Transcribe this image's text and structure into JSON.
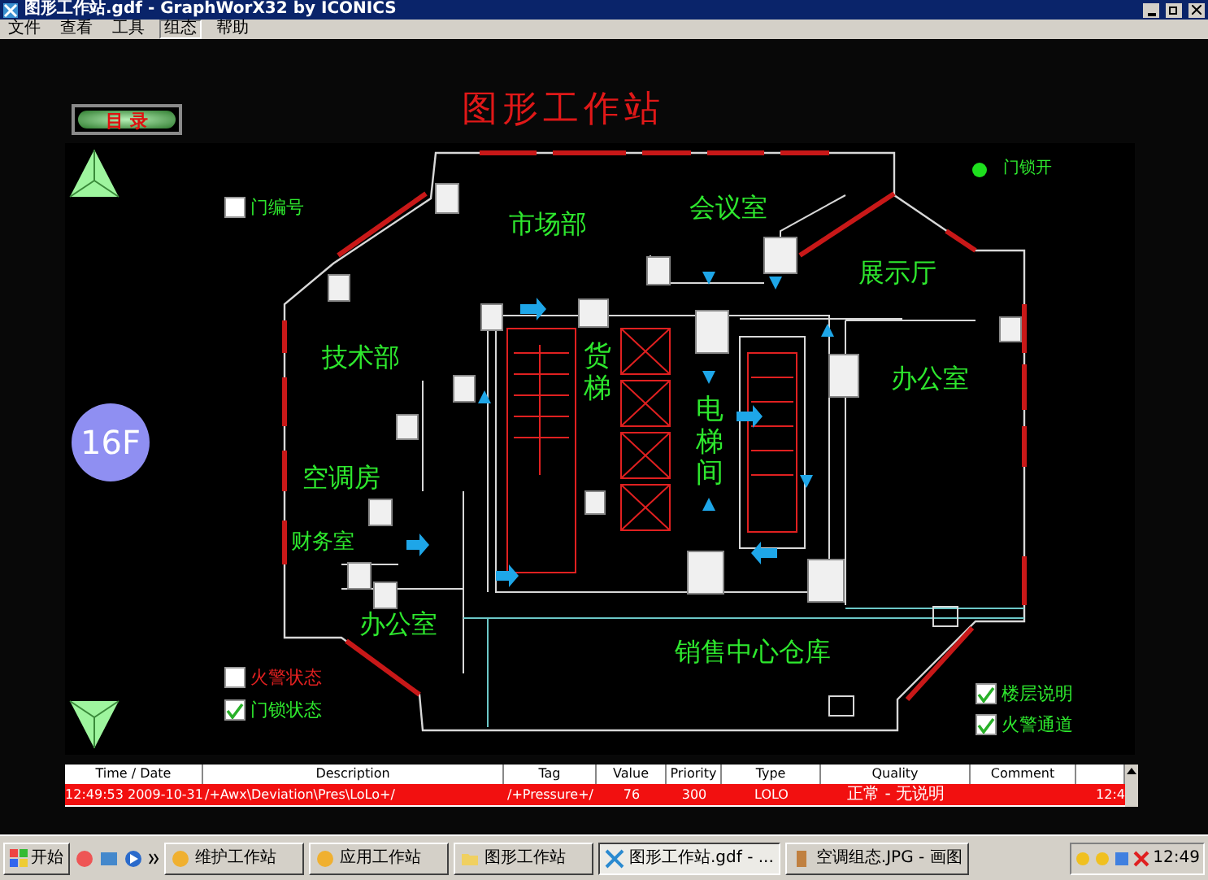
{
  "window": {
    "title": "图形工作站.gdf - GraphWorX32 by ICONICS"
  },
  "menu": [
    {
      "label": "文件",
      "selected": false
    },
    {
      "label": "查看",
      "selected": false
    },
    {
      "label": "工具",
      "selected": false
    },
    {
      "label": "组态",
      "selected": true
    },
    {
      "label": "帮助",
      "selected": false
    }
  ],
  "header": {
    "menu_button": "目 录",
    "title": "图形工作站"
  },
  "floor": {
    "label": "16F"
  },
  "rooms": [
    {
      "name": "市场部"
    },
    {
      "name": "会议室"
    },
    {
      "name": "展示厅"
    },
    {
      "name": "技术部"
    },
    {
      "name": "办公室"
    },
    {
      "name": "货梯"
    },
    {
      "name": "电梯间"
    },
    {
      "name": "空调房"
    },
    {
      "name": "财务室"
    },
    {
      "name": "办公室"
    },
    {
      "name": "销售中心仓库"
    }
  ],
  "legend": [
    {
      "label": "门编号",
      "checked": false,
      "kind": "normal"
    },
    {
      "label": "火警状态",
      "checked": false,
      "kind": "fire"
    },
    {
      "label": "门锁状态",
      "checked": true,
      "kind": "normal"
    },
    {
      "label": "楼层说明",
      "checked": true,
      "kind": "normal"
    },
    {
      "label": "火警通道",
      "checked": true,
      "kind": "normal"
    }
  ],
  "lamp": {
    "label": "门锁开",
    "on": true
  },
  "alarm_table": {
    "columns": [
      "Time / Date",
      "Description",
      "Tag",
      "Value",
      "Priority",
      "Type",
      "Quality",
      "Comment"
    ],
    "rows": [
      {
        "cells": [
          "12:49:53   2009-10-31",
          "/+Awx\\Deviation\\Pres\\LoLo+/",
          "/+Pressure+/",
          "76",
          "300",
          "LOLO",
          "正常 - 无说明",
          "",
          "12:4"
        ],
        "active": true
      }
    ]
  },
  "taskbar": {
    "start": "开始",
    "tasks": [
      {
        "label": "维护工作站",
        "selected": false,
        "kind": "app"
      },
      {
        "label": "应用工作站",
        "selected": false,
        "kind": "app"
      },
      {
        "label": "图形工作站",
        "selected": false,
        "kind": "folder"
      },
      {
        "label": "图形工作站.gdf - ...",
        "selected": true,
        "kind": "gdf"
      },
      {
        "label": "空调组态.JPG - 画图",
        "selected": false,
        "kind": "paint"
      }
    ],
    "clock": "12:49"
  }
}
